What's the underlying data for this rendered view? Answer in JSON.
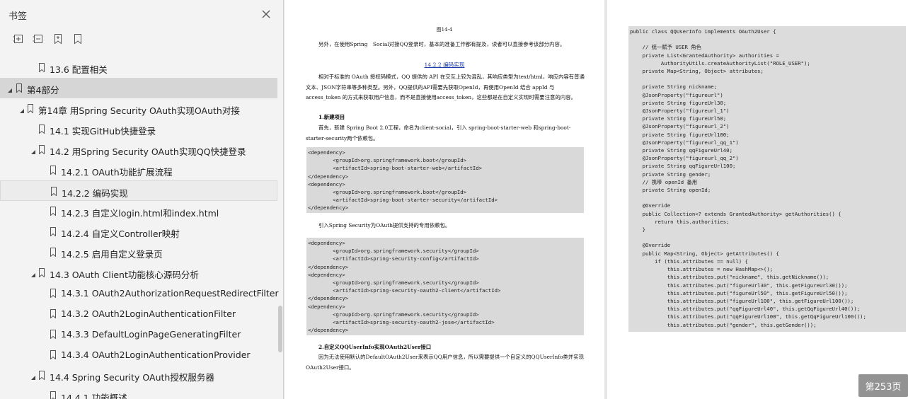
{
  "sidebar": {
    "title": "书签",
    "items": [
      {
        "label": "13.6 配置相关",
        "level": 2,
        "toggle": "none"
      },
      {
        "label": "第4部分",
        "level": 0,
        "toggle": "open",
        "selected": true
      },
      {
        "label": "第14章 用Spring Security OAuth实现OAuth对接",
        "level": 1,
        "toggle": "open"
      },
      {
        "label": "14.1 实现GitHub快捷登录",
        "level": 2,
        "toggle": "none"
      },
      {
        "label": "14.2 用Spring Security OAuth实现QQ快捷登录",
        "level": 2,
        "toggle": "open"
      },
      {
        "label": "14.2.1 OAuth功能扩展流程",
        "level": 3,
        "toggle": "none"
      },
      {
        "label": "14.2.2 编码实现",
        "level": 3,
        "toggle": "none",
        "hover": true
      },
      {
        "label": "14.2.3 自定义login.html和index.html",
        "level": 3,
        "toggle": "none"
      },
      {
        "label": "14.2.4 自定义Controller映射",
        "level": 3,
        "toggle": "none"
      },
      {
        "label": "14.2.5 启用自定义登录页",
        "level": 3,
        "toggle": "none"
      },
      {
        "label": "14.3 OAuth Client功能核心源码分析",
        "level": 2,
        "toggle": "open"
      },
      {
        "label": "14.3.1 OAuth2AuthorizationRequestRedirectFilter",
        "level": 3,
        "toggle": "none"
      },
      {
        "label": "14.3.2 OAuth2LoginAuthenticationFilter",
        "level": 3,
        "toggle": "none"
      },
      {
        "label": "14.3.3 DefaultLoginPageGeneratingFilter",
        "level": 3,
        "toggle": "none"
      },
      {
        "label": "14.3.4 OAuth2LoginAuthenticationProvider",
        "level": 3,
        "toggle": "none"
      },
      {
        "label": "14.4 Spring Security OAuth授权服务器",
        "level": 2,
        "toggle": "open"
      },
      {
        "label": "14.4.1 功能概述",
        "level": 3,
        "toggle": "none"
      }
    ]
  },
  "page1": {
    "caption": "图14-4",
    "para1": "另外，在使用Spring　Social对接QQ登录时，基本的准备工作都有提及，读者可以直接参考该部分内容。",
    "section": "14.2.2 编码实现",
    "para2": "相对于标准的 OAuth 授权码模式，QQ 提供的 API 在交互上较为混乱，其响应类型为text/html，响应内容有普通文本、JSON字符串等多种类型。另外，QQ提供的API需要先获取OpenId，再使用OpenId 结合 appId 与 access_token 的方式来获取用户信息，而不是直接使用access_token，这些都是在自定义实现时需要注意的内容。",
    "step1_title": "1.新建项目",
    "para3": "首先，新建 Spring Boot 2.0工程，命名为client-social，引入 spring-boot-starter-web 和spring-boot-starter-security两个依赖包。",
    "code1": "<dependency>\n        <groupId>org.springframework.boot</groupId>\n        <artifactId>spring-boot-starter-web</artifactId>\n</dependency>\n<dependency>\n        <groupId>org.springframework.boot</groupId>\n        <artifactId>spring-boot-starter-security</artifactId>\n</dependency>",
    "para4": "引入Spring Security为OAuth提供支持的专用依赖包。",
    "code2": "<dependency>\n        <groupId>org.springframework.security</groupId>\n        <artifactId>spring-security-config</artifactId>\n</dependency>\n<dependency>\n        <groupId>org.springframework.security</groupId>\n        <artifactId>spring-security-oauth2-client</artifactId>\n</dependency>\n<dependency>\n        <groupId>org.springframework.security</groupId>\n        <artifactId>spring-security-oauth2-jose</artifactId>\n</dependency>",
    "step2_title": "2.自定义QQUserInfo实现OAuth2User接口",
    "para5": "因为无法使用默认的DefaultOAuth2User来表示QQ用户信息，所以需要提供一个自定义的QQUserInfo类并实现OAuth2User接口。"
  },
  "page2": {
    "code": "public class QQUserInfo implements OAuth2User {\n\n    // 统一赋予 USER 角色\n    private List<GrantedAuthority> authorities =\n          AuthorityUtils.createAuthorityList(\"ROLE_USER\");\n    private Map<String, Object> attributes;\n\n    private String nickname;\n    @JsonProperty(\"figureurl\")\n    private String figureUrl30;\n    @JsonProperty(\"figureurl_1\")\n    private String figureUrl50;\n    @JsonProperty(\"figureurl_2\")\n    private String figureUrl100;\n    @JsonProperty(\"figureurl_qq_1\")\n    private String qqFigureUrl40;\n    @JsonProperty(\"figureurl_qq_2\")\n    private String qqFigureUrl100;\n    private String gender;\n    // 携带 openId 备用\n    private String openId;\n\n    @Override\n    public Collection<? extends GrantedAuthority> getAuthorities() {\n        return this.authorities;\n    }\n\n    @Override\n    public Map<String, Object> getAttributes() {\n        if (this.attributes == null) {\n            this.attributes = new HashMap<>();\n            this.attributes.put(\"nickname\", this.getNickname());\n            this.attributes.put(\"figureUrl30\", this.getFigureUrl30());\n            this.attributes.put(\"figureUrl50\", this.getFigureUrl50());\n            this.attributes.put(\"figureUrl100\", this.getFigureUrl100());\n            this.attributes.put(\"qqFigureUrl40\", this.getQqFigureUrl40());\n            this.attributes.put(\"qqFigureUrl100\", this.getQqFigureUrl100());\n            this.attributes.put(\"gender\", this.getGender());"
  },
  "page_indicator": "第253页"
}
